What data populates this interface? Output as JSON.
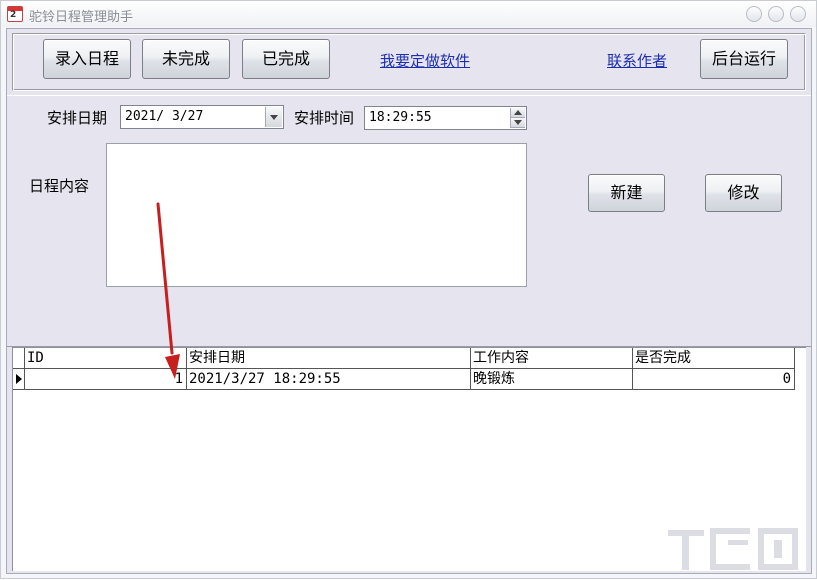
{
  "window": {
    "title": "驼铃日程管理助手",
    "icon_number": "2"
  },
  "toolbar": {
    "enter_schedule": "录入日程",
    "unfinished": "未完成",
    "finished": "已完成",
    "custom_software_link": "我要定做软件",
    "contact_author_link": "联系作者",
    "run_background": "后台运行"
  },
  "form": {
    "date_label": "安排日期",
    "date_value": "2021/ 3/27",
    "time_label": "安排时间",
    "time_value": "18:29:55",
    "content_label": "日程内容",
    "content_value": "",
    "new_button": "新建",
    "edit_button": "修改"
  },
  "grid": {
    "columns": [
      "ID",
      "安排日期",
      "工作内容",
      "是否完成"
    ],
    "rows": [
      {
        "id": "1",
        "date": "2021/3/27 18:29:55",
        "content": "晚锻炼",
        "done": "0"
      }
    ]
  },
  "annotation": {
    "arrow_color": "#c81e1e"
  }
}
